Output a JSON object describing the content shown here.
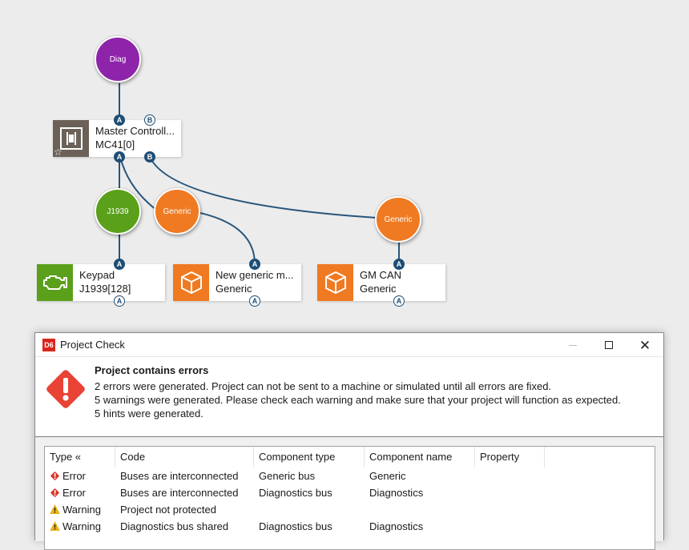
{
  "diagram": {
    "buses": [
      {
        "id": "diag",
        "label": "Diag",
        "color": "#8e24aa"
      },
      {
        "id": "j1939",
        "label": "J1939",
        "color": "#5aa01a"
      },
      {
        "id": "generic1",
        "label": "Generic",
        "color": "#ef7a22"
      },
      {
        "id": "generic2",
        "label": "Generic",
        "color": "#ef7a22"
      }
    ],
    "nodes": {
      "master": {
        "name": "Master Controll...",
        "sub": "MC41[0]"
      },
      "keypad": {
        "name": "Keypad",
        "sub": "J1939[128]"
      },
      "newgeneric": {
        "name": "New generic m...",
        "sub": "Generic"
      },
      "gmcan": {
        "name": "GM CAN",
        "sub": "Generic"
      }
    },
    "port_labels": {
      "a": "A",
      "b": "B"
    },
    "colors": {
      "line": "#27557a",
      "controller_icon_bg": "#6b6158",
      "keypad_icon_bg": "#5aa01a",
      "generic_icon_bg": "#ef7a22"
    }
  },
  "dialog": {
    "app_icon_label": "D6",
    "title": "Project Check",
    "header": "Project contains errors",
    "lines": [
      "2 errors were generated. Project can not be sent to a machine or simulated until all errors are fixed.",
      "5 warnings were generated. Please check each warning and make sure that your project will function as expected.",
      "5 hints were generated."
    ],
    "table": {
      "columns": [
        "Type «",
        "Code",
        "Component type",
        "Component name",
        "Property"
      ],
      "rows": [
        {
          "severity": "error",
          "type": "Error",
          "code": "Buses are interconnected",
          "component_type": "Generic bus",
          "component_name": "Generic",
          "property": ""
        },
        {
          "severity": "error",
          "type": "Error",
          "code": "Buses are interconnected",
          "component_type": "Diagnostics bus",
          "component_name": "Diagnostics",
          "property": ""
        },
        {
          "severity": "warning",
          "type": "Warning",
          "code": "Project not protected",
          "component_type": "",
          "component_name": "",
          "property": ""
        },
        {
          "severity": "warning",
          "type": "Warning",
          "code": "Diagnostics bus shared",
          "component_type": "Diagnostics bus",
          "component_name": "Diagnostics",
          "property": ""
        }
      ]
    },
    "colors": {
      "error": "#d9352a",
      "warning": "#e8b31a"
    }
  }
}
